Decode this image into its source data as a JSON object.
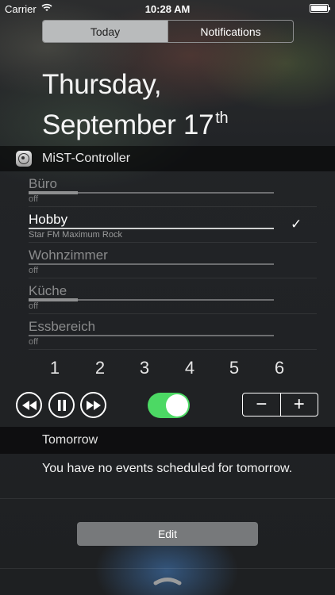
{
  "status_bar": {
    "carrier": "Carrier",
    "time": "10:28 AM",
    "battery_level": 1.0,
    "icons": [
      "wifi-icon",
      "battery-icon"
    ]
  },
  "tabs": [
    {
      "label": "Today",
      "active": true
    },
    {
      "label": "Notifications",
      "active": false
    }
  ],
  "date": {
    "line1": "Thursday,",
    "line2": "September 17",
    "suffix": "th"
  },
  "widget": {
    "title": "MiST-Controller",
    "icon": "mist-controller-app-icon",
    "rooms": [
      {
        "name": "Büro",
        "status": "off",
        "active": false
      },
      {
        "name": "Hobby",
        "status": "Star FM Maximum Rock",
        "active": true,
        "selected": true
      },
      {
        "name": "Wohnzimmer",
        "status": "off",
        "active": false
      },
      {
        "name": "Küche",
        "status": "off",
        "active": false
      },
      {
        "name": "Essbereich",
        "status": "off",
        "active": false
      }
    ],
    "presets": [
      "1",
      "2",
      "3",
      "4",
      "5",
      "6"
    ],
    "controls": {
      "rewind_icon": "rewind-icon",
      "pause_icon": "pause-icon",
      "forward_icon": "fast-forward-icon",
      "power_on": true,
      "minus_label": "−",
      "plus_label": "+"
    }
  },
  "tomorrow": {
    "title": "Tomorrow",
    "message": "You have no events scheduled for tomorrow."
  },
  "edit_label": "Edit",
  "colors": {
    "toggle_on": "#4cd964",
    "segment_active": "#b9bbbc",
    "edit_button": "#77797b"
  }
}
